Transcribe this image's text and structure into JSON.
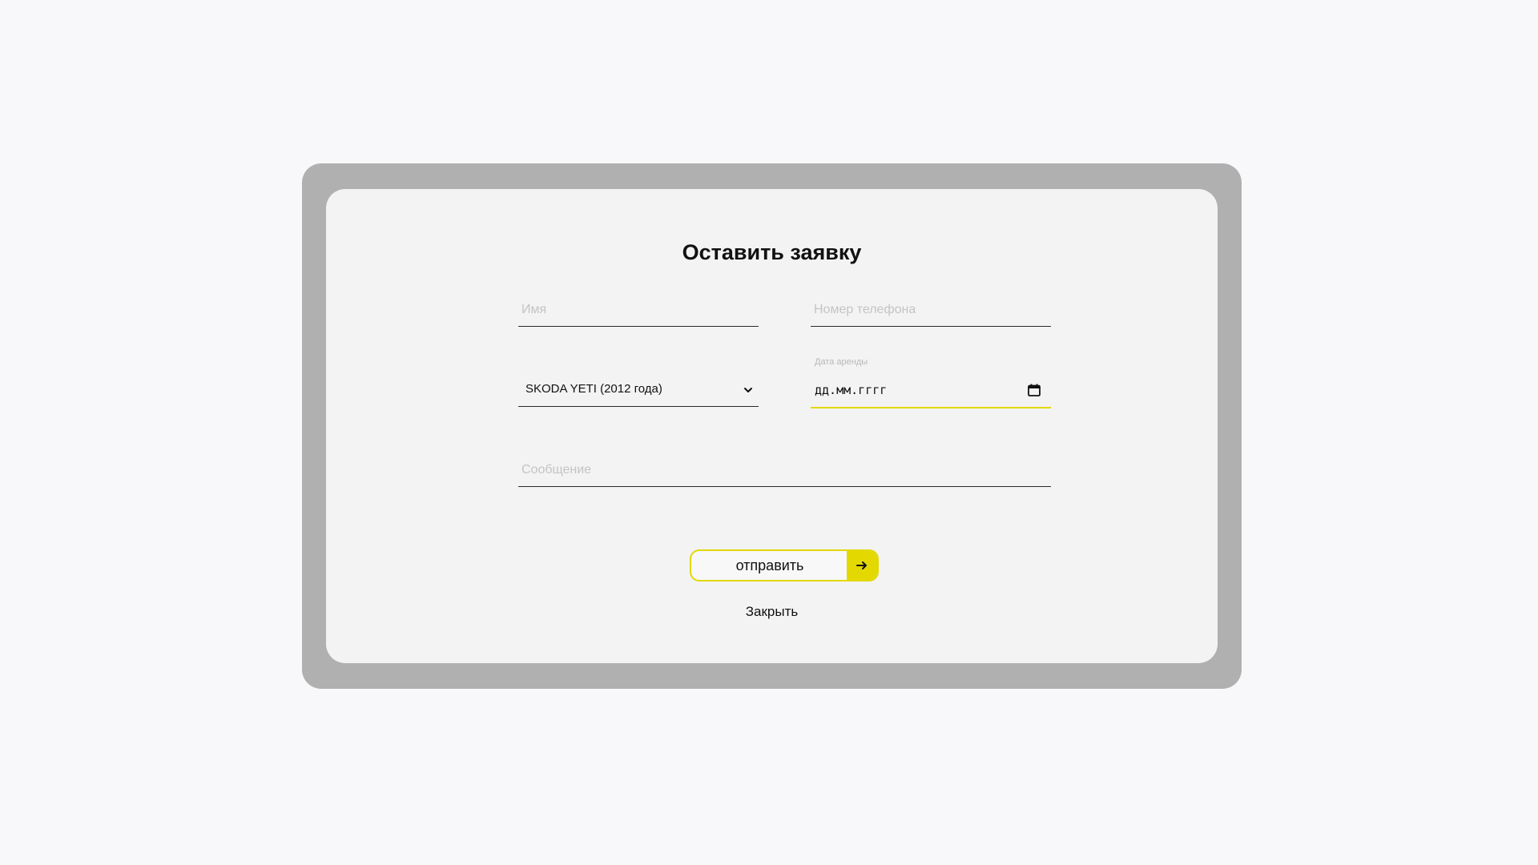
{
  "form": {
    "title": "Оставить заявку",
    "name_placeholder": "Имя",
    "phone_placeholder": "Номер телефона",
    "car_select_value": "SKODA YETI (2012 года)",
    "date_label": "Дата аренды",
    "date_value": "дд.мм.гггг",
    "message_placeholder": "Сообщение",
    "submit_label": "отправить",
    "close_label": "Закрыть"
  },
  "icons": {
    "select": "chevron-down-icon",
    "date": "calendar-icon",
    "submit": "arrow-right-icon"
  },
  "colors": {
    "accent": "#e3d800",
    "overlay": "#b0b0b0",
    "modal_bg": "#f3f3f3"
  }
}
